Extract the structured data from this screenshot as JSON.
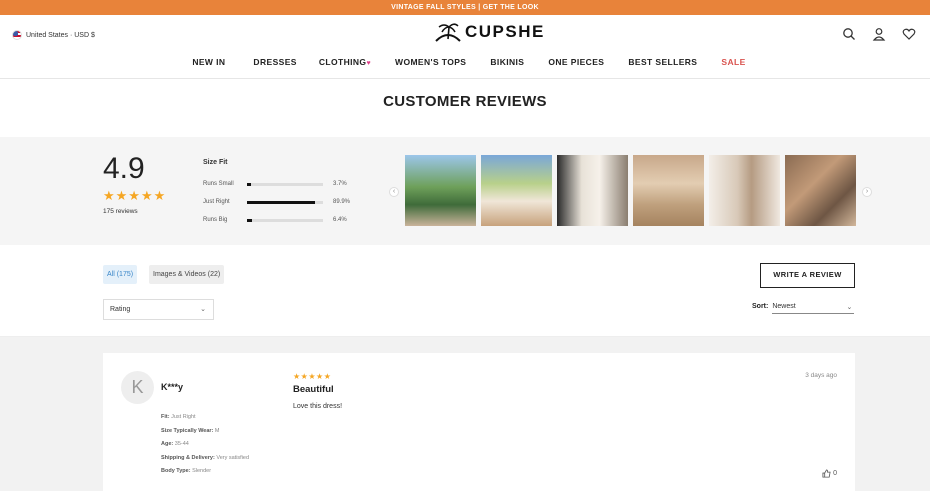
{
  "promo": "VINTAGE FALL STYLES | GET THE LOOK",
  "header": {
    "region": "United States · USD $",
    "logo": "CUPSHE"
  },
  "nav": [
    {
      "label": "NEW IN"
    },
    {
      "label": "DRESSES"
    },
    {
      "label": "CLOTHING"
    },
    {
      "label": "WOMEN'S TOPS"
    },
    {
      "label": "BIKINIS"
    },
    {
      "label": "ONE PIECES"
    },
    {
      "label": "BEST SELLERS"
    },
    {
      "label": "SALE"
    }
  ],
  "page_title": "CUSTOMER REVIEWS",
  "summary": {
    "rating": "4.9",
    "stars": "★★★★★",
    "review_count": "175 reviews",
    "size_fit": {
      "title": "Size Fit",
      "rows": [
        {
          "label": "Runs Small",
          "pct": "3.7%",
          "value": 3.7
        },
        {
          "label": "Just Right",
          "pct": "89.9%",
          "value": 89.9
        },
        {
          "label": "Runs Big",
          "pct": "6.4%",
          "value": 6.4
        }
      ]
    }
  },
  "filters": {
    "all": "All (175)",
    "images": "Images & Videos (22)",
    "write_review": "WRITE A REVIEW",
    "rating_select": "Rating",
    "sort_label": "Sort:",
    "sort_value": "Newest"
  },
  "review": {
    "avatar_letter": "K",
    "name": "K***y",
    "fit_label": "Fit:",
    "fit": "Just Right",
    "size_label": "Size Typically Wear:",
    "size": "M",
    "age_label": "Age:",
    "age": "35-44",
    "ship_label": "Shipping & Delivery:",
    "ship": "Very satisfied",
    "body_label": "Body Type:",
    "body": "Slender",
    "stars": "★★★★★",
    "title": "Beautiful",
    "body_text": "Love this dress!",
    "date": "3 days ago",
    "likes": "0"
  }
}
